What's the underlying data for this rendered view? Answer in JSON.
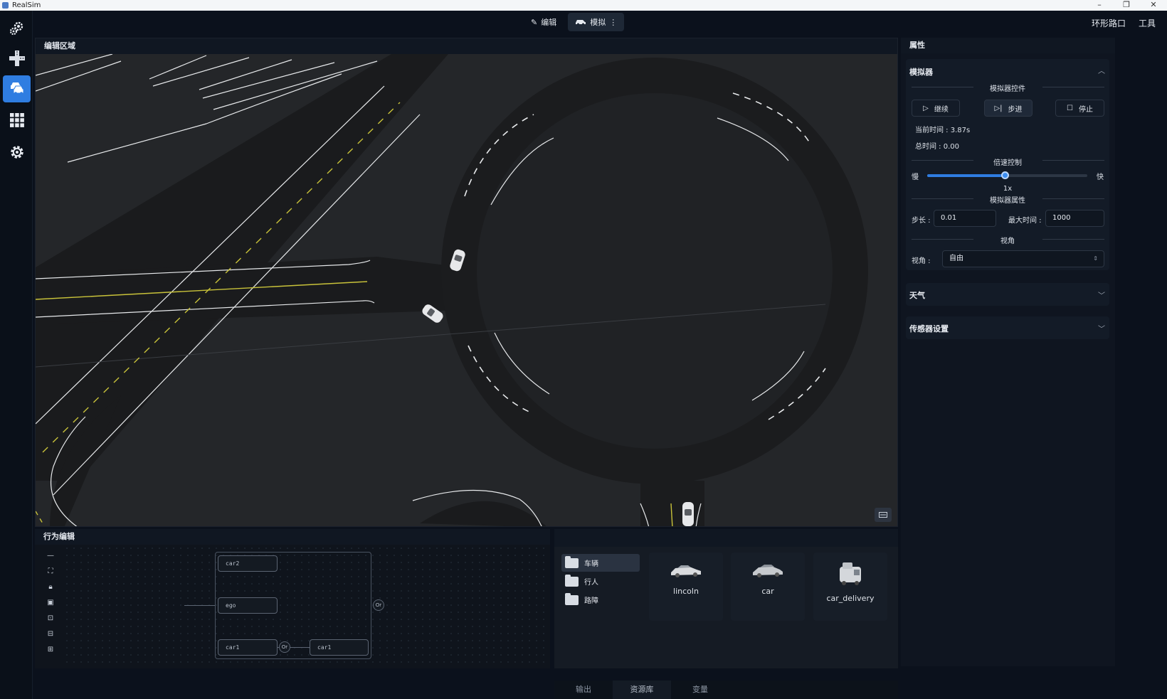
{
  "window": {
    "title": "RealSim"
  },
  "toolbar": {
    "mode_tabs": [
      {
        "label": "编辑"
      },
      {
        "label": "模拟"
      }
    ],
    "right_items": [
      "环形路口",
      "工具"
    ]
  },
  "editor": {
    "title": "编辑区域"
  },
  "properties": {
    "title": "属性",
    "simulator": {
      "title": "模拟器",
      "controls_title": "模拟器控件",
      "buttons": {
        "continue": "继续",
        "step": "步进",
        "stop": "停止"
      },
      "current_time": "当前时间 : 3.87s",
      "total_time": "总时间 : 0.00",
      "speed_title": "倍速控制",
      "speed_slow": "慢",
      "speed_fast": "快",
      "speed_value": "1x",
      "speed_fraction": 0.49,
      "attrs_title": "模拟器属性",
      "step_label": "步长 :",
      "step_value": "0.01",
      "max_time_label": "最大时间 :",
      "max_time_value": "1000",
      "view_title": "视角",
      "view_label": "视角 :",
      "view_value": "自由"
    },
    "weather": {
      "title": "天气"
    },
    "sensors": {
      "title": "传感器设置"
    }
  },
  "behavior": {
    "title": "行为编辑",
    "nodes": {
      "car2": "car2",
      "ego": "ego",
      "car1_a": "car1",
      "car1_b": "car1"
    },
    "or_label": "Or"
  },
  "resources": {
    "categories": [
      "车辆",
      "行人",
      "路障"
    ],
    "assets": [
      {
        "label": "lincoln"
      },
      {
        "label": "car"
      },
      {
        "label": "car_delivery"
      }
    ]
  },
  "bottom_tabs": [
    "输出",
    "资源库",
    "变量"
  ]
}
